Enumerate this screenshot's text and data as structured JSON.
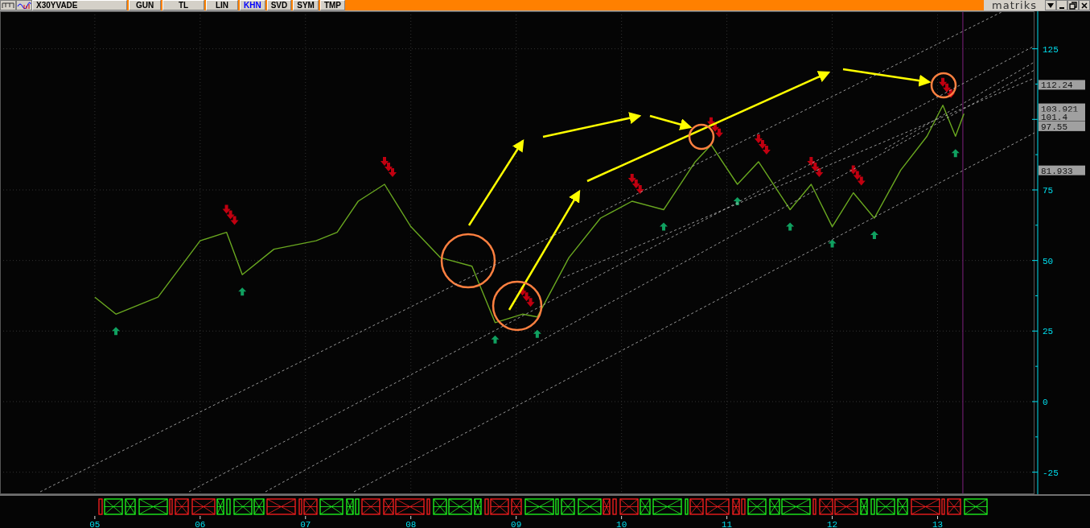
{
  "toolbar": {
    "symbol": "X30YVADE",
    "buttons": [
      {
        "label": "GUN",
        "selected": false
      },
      {
        "label": "TL",
        "selected": false
      },
      {
        "label": "LIN",
        "selected": false
      },
      {
        "label": "KHN",
        "selected": true
      },
      {
        "label": "SVD",
        "selected": false
      },
      {
        "label": "SYM",
        "selected": false
      },
      {
        "label": "TMP",
        "selected": false
      }
    ],
    "logo": "matriks"
  },
  "chart": {
    "price_labels": [
      "112.24",
      "103.921",
      "101.4",
      "97.55",
      "81.933"
    ],
    "chart_data": {
      "type": "line",
      "x": [
        2005.0,
        2005.2,
        2005.6,
        2006.0,
        2006.25,
        2006.4,
        2006.7,
        2007.1,
        2007.3,
        2007.5,
        2007.75,
        2008.0,
        2008.28,
        2008.58,
        2008.8,
        2009.06,
        2009.2,
        2009.5,
        2009.8,
        2010.1,
        2010.4,
        2010.7,
        2010.85,
        2011.1,
        2011.3,
        2011.6,
        2011.8,
        2012.0,
        2012.2,
        2012.4,
        2012.65,
        2012.9,
        2013.05,
        2013.17,
        2013.25
      ],
      "series": [
        {
          "values": [
            37,
            31,
            37,
            57,
            60,
            45,
            54,
            57,
            60,
            71,
            77,
            62,
            51,
            48,
            28,
            31,
            30,
            51,
            65,
            71,
            68,
            85,
            91,
            77,
            85,
            68,
            77,
            62,
            74,
            65,
            82,
            94,
            105,
            94,
            102
          ]
        }
      ],
      "xticks": [
        {
          "value": 2005,
          "label": "05"
        },
        {
          "value": 2006,
          "label": "06"
        },
        {
          "value": 2007,
          "label": "07"
        },
        {
          "value": 2008,
          "label": "08"
        },
        {
          "value": 2009,
          "label": "09"
        },
        {
          "value": 2010,
          "label": "10"
        },
        {
          "value": 2011,
          "label": "11"
        },
        {
          "value": 2012,
          "label": "12"
        },
        {
          "value": 2013,
          "label": "13"
        }
      ],
      "ref_lines": [
        {
          "axis": "x",
          "value": 2013.24
        }
      ],
      "xlim": [
        2004.1,
        2013.92
      ],
      "ylim": [
        -32.8,
        138.3
      ],
      "grid": true,
      "yticks": [
        125,
        75,
        50,
        25,
        0,
        -25
      ]
    }
  }
}
